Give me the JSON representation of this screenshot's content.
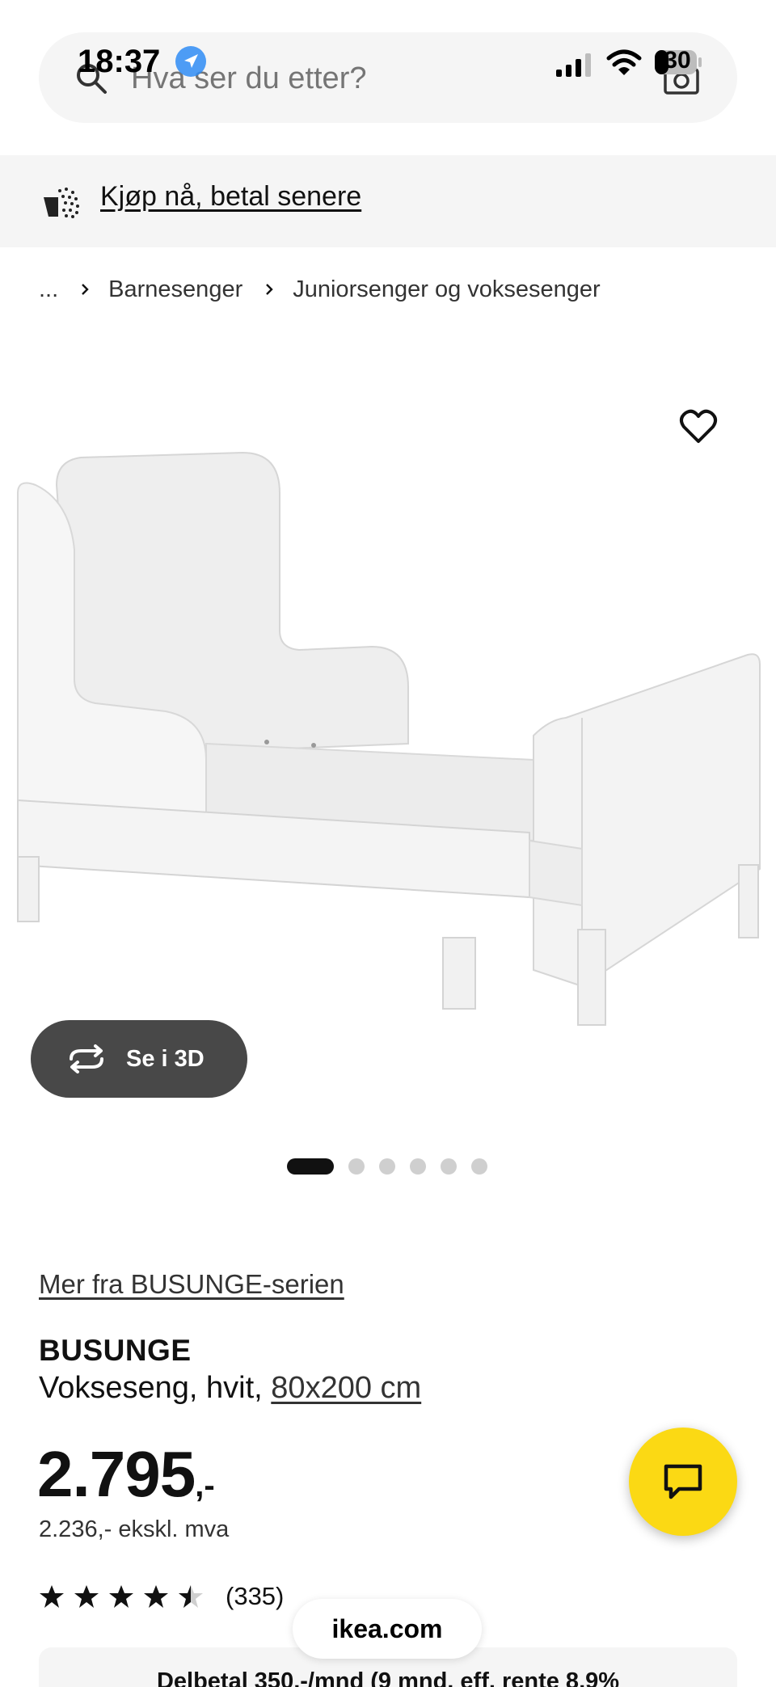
{
  "status_bar": {
    "time": "18:37",
    "battery": "30"
  },
  "search": {
    "placeholder": "Hva ser du etter?"
  },
  "banner": {
    "link_text": "Kjøp nå, betal senere"
  },
  "breadcrumb": {
    "items": [
      "...",
      "Barnesenger",
      "Juniorsenger og voksesenger"
    ]
  },
  "gallery": {
    "see3d_label": "Se i 3D",
    "slide_count": 6,
    "active_slide": 1
  },
  "product": {
    "series_link": "Mer fra BUSUNGE-serien",
    "name": "BUSUNGE",
    "description": "Vokseseng, hvit,",
    "size_link": "80x200 cm",
    "price_main": "2.795",
    "price_suffix": ",-",
    "price_excl": "2.236,- ekskl. mva",
    "rating_value": 4.5,
    "review_count": "(335)"
  },
  "installment": {
    "text": "Delbetal 350,-/mnd (9 mnd, eff. rente 8,9%"
  },
  "browser": {
    "url": "ikea.com"
  },
  "colors": {
    "chat_button": "#fbd914",
    "see3d_button": "#484848",
    "banner_bg": "#f5f5f5",
    "location_blue": "#2f8cf5"
  },
  "icons": [
    "search-icon",
    "camera-icon",
    "location-icon",
    "signal-icon",
    "wifi-icon",
    "battery-icon",
    "basket-icon",
    "chevron-right-icon",
    "heart-icon",
    "rotate-3d-icon",
    "star-icon",
    "chat-icon"
  ]
}
